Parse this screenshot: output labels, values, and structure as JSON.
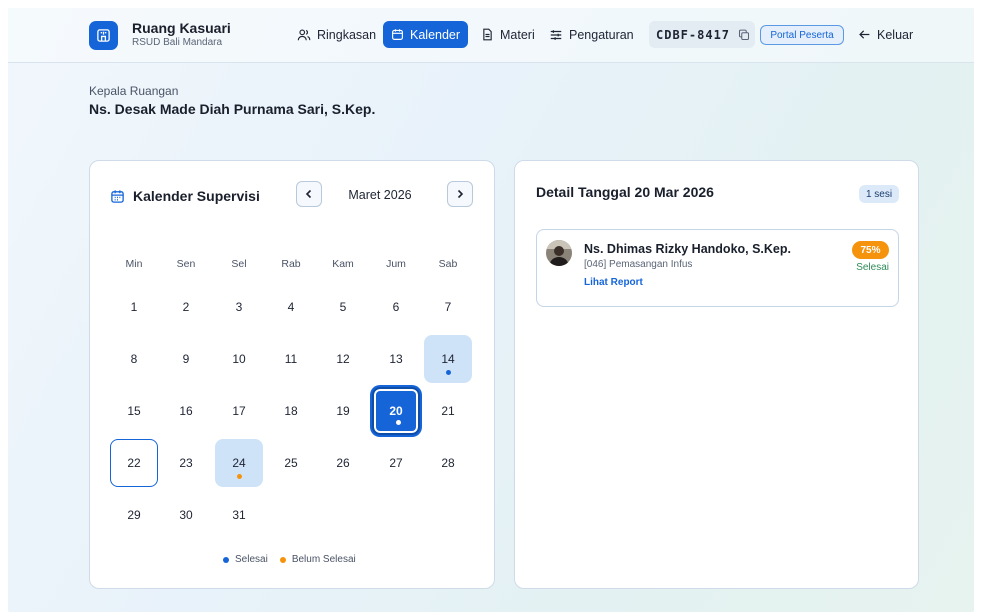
{
  "header": {
    "app_title": "Ruang Kasuari",
    "app_subtitle": "RSUD Bali Mandara",
    "nav": [
      {
        "label": "Ringkasan",
        "icon": "users-icon",
        "active": false
      },
      {
        "label": "Kalender",
        "icon": "calendar-icon",
        "active": true
      },
      {
        "label": "Materi",
        "icon": "document-icon",
        "active": false
      },
      {
        "label": "Pengaturan",
        "icon": "sliders-icon",
        "active": false
      }
    ],
    "code": "CDBF-8417",
    "portal_label": "Portal Peserta",
    "logout_label": "Keluar"
  },
  "head": {
    "label": "Kepala Ruangan",
    "name": "Ns. Desak Made Diah Purnama Sari, S.Kep."
  },
  "calendar": {
    "title": "Kalender Supervisi",
    "month_label": "Maret 2026",
    "weekdays": [
      "Min",
      "Sen",
      "Sel",
      "Rab",
      "Kam",
      "Jum",
      "Sab"
    ],
    "days": [
      {
        "n": "1"
      },
      {
        "n": "2"
      },
      {
        "n": "3"
      },
      {
        "n": "4"
      },
      {
        "n": "5"
      },
      {
        "n": "6"
      },
      {
        "n": "7"
      },
      {
        "n": "8"
      },
      {
        "n": "9"
      },
      {
        "n": "10"
      },
      {
        "n": "11"
      },
      {
        "n": "12"
      },
      {
        "n": "13"
      },
      {
        "n": "14",
        "state": "session",
        "dot": "done"
      },
      {
        "n": "15"
      },
      {
        "n": "16"
      },
      {
        "n": "17"
      },
      {
        "n": "18"
      },
      {
        "n": "19"
      },
      {
        "n": "20",
        "state": "selected",
        "dot": "done-white"
      },
      {
        "n": "21"
      },
      {
        "n": "22",
        "state": "today"
      },
      {
        "n": "23"
      },
      {
        "n": "24",
        "state": "session",
        "dot": "pending"
      },
      {
        "n": "25"
      },
      {
        "n": "26"
      },
      {
        "n": "27"
      },
      {
        "n": "28"
      },
      {
        "n": "29"
      },
      {
        "n": "30"
      },
      {
        "n": "31"
      }
    ],
    "legend": [
      {
        "label": "Selesai",
        "color": "#1565d8"
      },
      {
        "label": "Belum Selesai",
        "color": "#f5930c"
      }
    ]
  },
  "detail": {
    "title": "Detail Tanggal 20 Mar 2026",
    "badge": "1 sesi",
    "sessions": [
      {
        "name": "Ns. Dhimas Rizky Handoko, S.Kep.",
        "topic": "[046] Pemasangan Infus",
        "link_label": "Lihat Report",
        "percent": "75%",
        "status": "Selesai"
      }
    ]
  },
  "colors": {
    "accent": "#1565d8",
    "pending": "#f5930c",
    "done_text": "#2e8b57"
  }
}
